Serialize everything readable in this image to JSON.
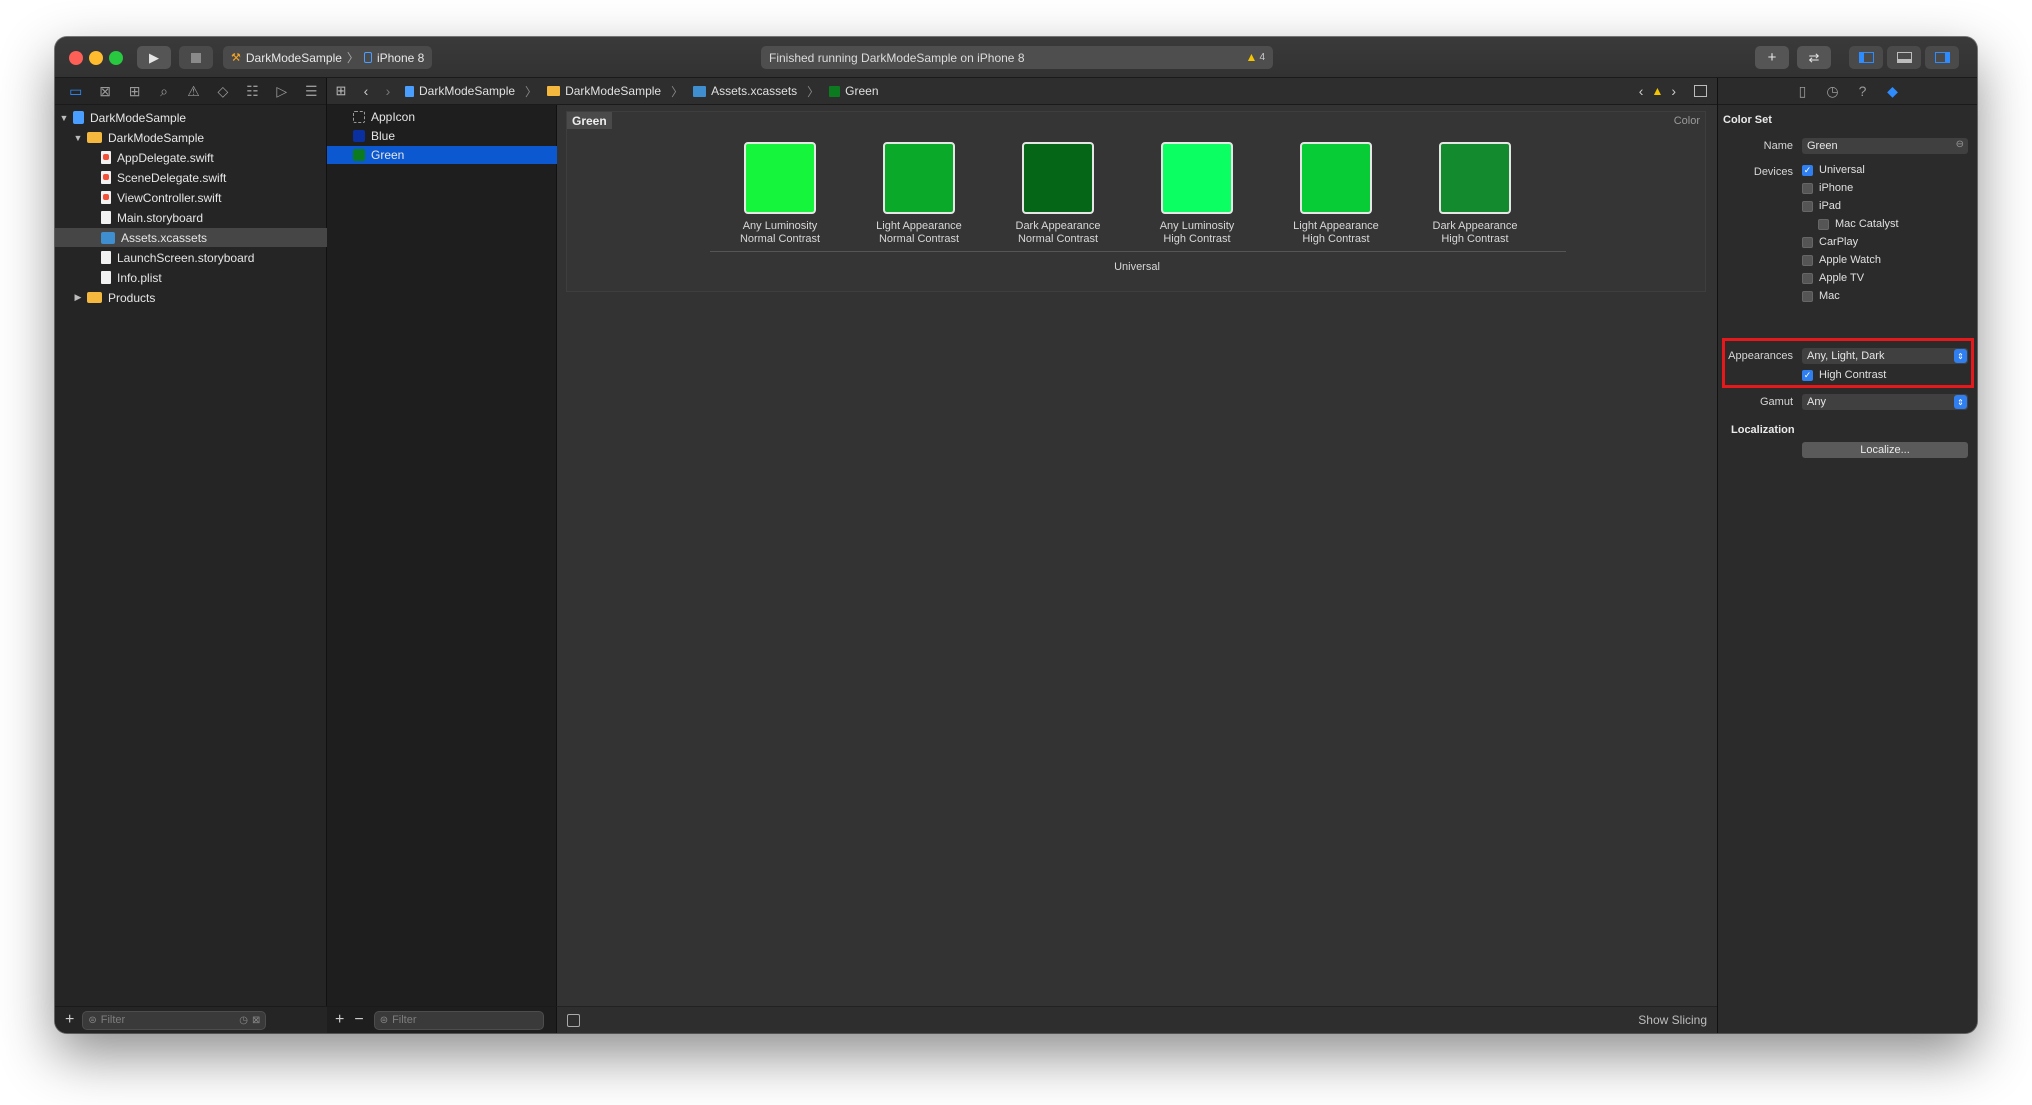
{
  "toolbar": {
    "scheme_project": "DarkModeSample",
    "scheme_device": "iPhone 8",
    "activity_status": "Finished running DarkModeSample on iPhone 8",
    "warning_count": "4",
    "add_button": "+",
    "code_review_button": "⇄"
  },
  "navigator": {
    "items": [
      {
        "label": "DarkModeSample",
        "kind": "project",
        "indent": 0,
        "expanded": true
      },
      {
        "label": "DarkModeSample",
        "kind": "folder",
        "indent": 1,
        "expanded": true
      },
      {
        "label": "AppDelegate.swift",
        "kind": "swift",
        "indent": 2
      },
      {
        "label": "SceneDelegate.swift",
        "kind": "swift",
        "indent": 2
      },
      {
        "label": "ViewController.swift",
        "kind": "swift",
        "indent": 2
      },
      {
        "label": "Main.storyboard",
        "kind": "file",
        "indent": 2
      },
      {
        "label": "Assets.xcassets",
        "kind": "assets",
        "indent": 2,
        "selected": true
      },
      {
        "label": "LaunchScreen.storyboard",
        "kind": "file",
        "indent": 2
      },
      {
        "label": "Info.plist",
        "kind": "file",
        "indent": 2
      },
      {
        "label": "Products",
        "kind": "folder",
        "indent": 1,
        "expanded": false
      }
    ],
    "filter_placeholder": "Filter"
  },
  "jumpbar": {
    "crumbs": [
      "DarkModeSample",
      "DarkModeSample",
      "Assets.xcassets",
      "Green"
    ]
  },
  "assets": {
    "items": [
      {
        "label": "AppIcon",
        "color": "",
        "selected": false
      },
      {
        "label": "Blue",
        "color": "#0a2f9e",
        "selected": false
      },
      {
        "label": "Green",
        "color": "#0c7a1f",
        "selected": true
      }
    ],
    "filter_placeholder": "Filter"
  },
  "colorset": {
    "title": "Green",
    "kind": "Color",
    "group_label": "Universal",
    "cells": [
      {
        "line1": "Any Luminosity",
        "line2": "Normal Contrast",
        "color": "#14f53c"
      },
      {
        "line1": "Light Appearance",
        "line2": "Normal Contrast",
        "color": "#0aa92a"
      },
      {
        "line1": "Dark Appearance",
        "line2": "Normal Contrast",
        "color": "#066617"
      },
      {
        "line1": "Any Luminosity",
        "line2": "High Contrast",
        "color": "#0bff63"
      },
      {
        "line1": "Light Appearance",
        "line2": "High Contrast",
        "color": "#08cc36"
      },
      {
        "line1": "Dark Appearance",
        "line2": "High Contrast",
        "color": "#128a2d"
      }
    ],
    "show_slicing": "Show Slicing"
  },
  "inspector": {
    "section_title": "Color Set",
    "name_label": "Name",
    "name_value": "Green",
    "devices_label": "Devices",
    "devices": [
      {
        "label": "Universal",
        "checked": true,
        "indent": 0
      },
      {
        "label": "iPhone",
        "checked": false,
        "indent": 0
      },
      {
        "label": "iPad",
        "checked": false,
        "indent": 0
      },
      {
        "label": "Mac Catalyst",
        "checked": false,
        "indent": 1
      },
      {
        "label": "CarPlay",
        "checked": false,
        "indent": 0
      },
      {
        "label": "Apple Watch",
        "checked": false,
        "indent": 0
      },
      {
        "label": "Apple TV",
        "checked": false,
        "indent": 0
      },
      {
        "label": "Mac",
        "checked": false,
        "indent": 0
      }
    ],
    "appearances_label": "Appearances",
    "appearances_value": "Any, Light, Dark",
    "high_contrast_label": "High Contrast",
    "high_contrast_checked": true,
    "gamut_label": "Gamut",
    "gamut_value": "Any",
    "localization_title": "Localization",
    "localize_button": "Localize..."
  },
  "colors": {
    "accent": "#2f7ff0",
    "highlight": "#e5191c",
    "selection": "#0b58d0"
  }
}
